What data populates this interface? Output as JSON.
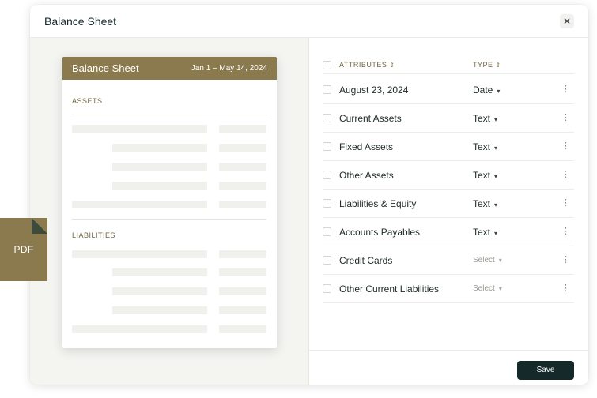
{
  "modal": {
    "title": "Balance Sheet",
    "close_glyph": "✕"
  },
  "document": {
    "title": "Balance Sheet",
    "date_range": "Jan 1 – May 14, 2024",
    "sections": [
      "ASSETS",
      "LIABILITIES"
    ]
  },
  "badge": {
    "label": "PDF"
  },
  "attributes": {
    "header_attr": "ATTRIBUTES",
    "header_type": "TYPE",
    "rows": [
      {
        "name": "August 23, 2024",
        "type": "Date"
      },
      {
        "name": "Current Assets",
        "type": "Text"
      },
      {
        "name": "Fixed Assets",
        "type": "Text"
      },
      {
        "name": "Other Assets",
        "type": "Text"
      },
      {
        "name": "Liabilities & Equity",
        "type": "Text"
      },
      {
        "name": "Accounts Payables",
        "type": "Text"
      },
      {
        "name": "Credit Cards",
        "type": "Select"
      },
      {
        "name": "Other Current Liabilities",
        "type": "Select"
      }
    ]
  },
  "footer": {
    "save_label": "Save"
  },
  "colors": {
    "accent": "#8a7a4e",
    "dark": "#16292a"
  }
}
